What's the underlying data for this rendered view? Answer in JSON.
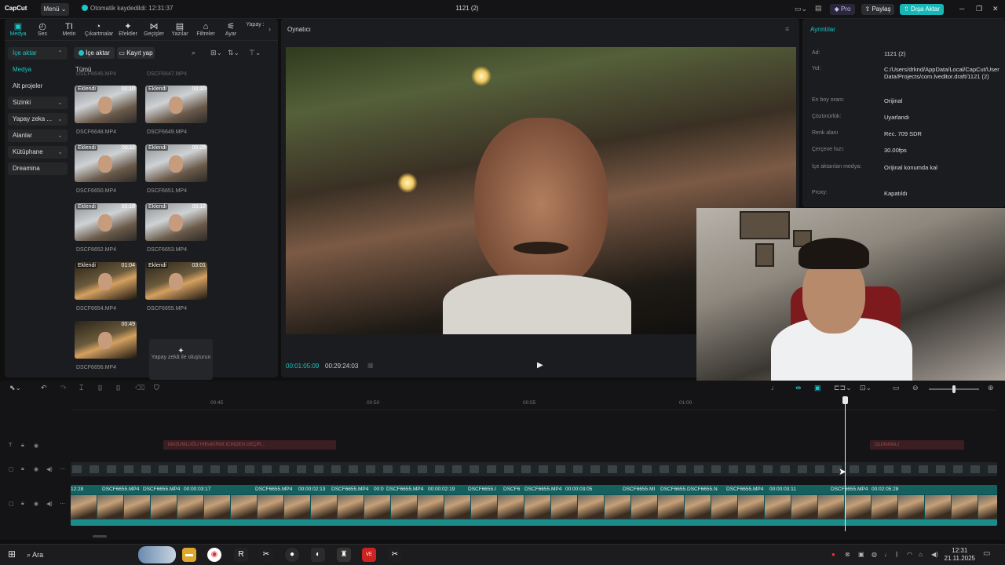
{
  "app": {
    "logo": "CapCut",
    "menu_label": "Menü",
    "autosave_text": "Otomatik kaydedildi: 12:31:37",
    "project_title": "1121 (2)",
    "pro_label": "Pro",
    "share_label": "Paylaş",
    "export_label": "Dışa Aktar"
  },
  "toolbar": {
    "tabs": [
      {
        "label": "Medya",
        "icon": "▣"
      },
      {
        "label": "Ses",
        "icon": "◴"
      },
      {
        "label": "Metin",
        "icon": "TI"
      },
      {
        "label": "Çıkartmalar",
        "icon": "◔"
      },
      {
        "label": "Efektler",
        "icon": "✦"
      },
      {
        "label": "Geçişler",
        "icon": "⋈"
      },
      {
        "label": "Yazılar",
        "icon": "▤"
      },
      {
        "label": "Filtreler",
        "icon": "⌂"
      },
      {
        "label": "Ayar",
        "icon": "⚟"
      },
      {
        "label": "Yapay :",
        "icon": ""
      }
    ]
  },
  "sidenav": {
    "items": [
      {
        "label": "İçe aktar",
        "caret": "⌃"
      },
      {
        "label": "Medya",
        "caret": ""
      },
      {
        "label": "Alt projeler",
        "caret": ""
      },
      {
        "label": "Sizinki",
        "caret": "⌄"
      },
      {
        "label": "Yapay zeka ...",
        "caret": "⌄"
      },
      {
        "label": "Alanlar",
        "caret": "⌄"
      },
      {
        "label": "Kütüphane",
        "caret": "⌄"
      },
      {
        "label": "Dreamina",
        "caret": ""
      }
    ]
  },
  "media": {
    "import_label": "İçe aktar",
    "record_label": "Kayıt yap",
    "all_label": "Tümü",
    "top_partial_left": "DSCF6646.MP4",
    "top_partial_right": "DSCF6647.MP4",
    "clips": [
      {
        "name": "DSCF6648.MP4",
        "duration": "00:10",
        "tag": "Eklendi",
        "night": false
      },
      {
        "name": "DSCF6649.MP4",
        "duration": "00:10",
        "tag": "Eklendi",
        "night": false
      },
      {
        "name": "DSCF6650.MP4",
        "duration": "00:11",
        "tag": "Eklendi",
        "night": false
      },
      {
        "name": "DSCF6651.MP4",
        "duration": "00:25",
        "tag": "Eklendi",
        "night": false
      },
      {
        "name": "DSCF6652.MP4",
        "duration": "00:16",
        "tag": "Eklendi",
        "night": false
      },
      {
        "name": "DSCF6653.MP4",
        "duration": "00:12",
        "tag": "Eklendi",
        "night": false
      },
      {
        "name": "DSCF6654.MP4",
        "duration": "01:04",
        "tag": "Eklendi",
        "night": true
      },
      {
        "name": "DSCF6655.MP4",
        "duration": "03:01",
        "tag": "Eklendi",
        "night": true
      },
      {
        "name": "DSCF6656.MP4",
        "duration": "00:49",
        "tag": "",
        "night": true
      }
    ],
    "ai_create_label": "Yapay zekâ ile oluşturun"
  },
  "player": {
    "title": "Oynatıcı",
    "current_time": "00:01:05:09",
    "total_time": "00:29:24:03"
  },
  "details": {
    "title": "Ayrıntılar",
    "rows": [
      {
        "k": "Ad:",
        "v": "1121 (2)"
      },
      {
        "k": "Yol:",
        "v": "C:/Users/drknd/AppData/Local/CapCut/User Data/Projects/com.lveditor.draft/1121 (2)"
      },
      {
        "k": "En boy oranı:",
        "v": "Orijinal"
      },
      {
        "k": "Çözünürlük:",
        "v": "Uyarlandı"
      },
      {
        "k": "Renk alanı",
        "v": "Rec. 709 SDR"
      },
      {
        "k": "Çerçeve hızı:",
        "v": "30.00fps"
      },
      {
        "k": "İçe aktarılan medya:",
        "v": "Orijinal konumda kal"
      },
      {
        "k": "Proxy:",
        "v": "Kapatıldı"
      }
    ]
  },
  "timeline": {
    "ruler": [
      "00:45",
      "00:50",
      "00:55",
      "01:00"
    ],
    "text_clips": [
      "MASUMLUĞU HIRAKIRIM ICINDEN GEÇİR...",
      "OLMAMALI"
    ],
    "main_labels": [
      "12:28",
      "DSCF6655.MP4",
      "DSCF6655.MP4",
      "00:00:03:17",
      "DSCF6655.MP4",
      "00:00:02:13",
      "DSCF6655.MP4",
      "00:0",
      "DSCF6655.MP4",
      "00:00:02:19",
      "DSCF6655.I",
      "DSCF6",
      "DSCF6655.MP4",
      "00:00:03:05",
      "DSCF6655.MI",
      "DSCF6655.",
      "DSCF6655.N",
      "DSCF6655.MP4",
      "00:00:03:11",
      "DSCF6655.MP4",
      "00:02:05:28"
    ]
  },
  "taskbar": {
    "search_label": "Ara",
    "time": "12:31",
    "date": "21.11.2025"
  }
}
